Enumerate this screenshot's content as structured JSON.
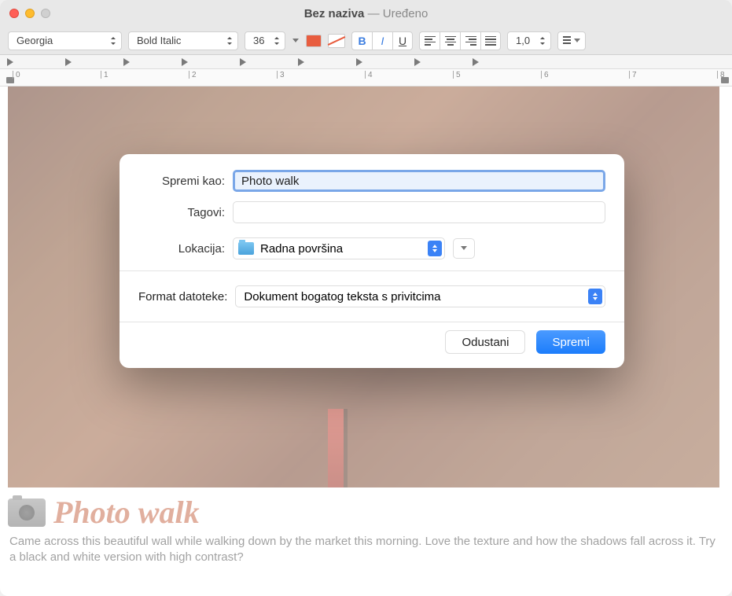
{
  "window": {
    "title_main": "Bez naziva",
    "title_edited": "— Uređeno"
  },
  "toolbar": {
    "font": "Georgia",
    "style": "Bold Italic",
    "size": "36",
    "spacing": "1,0"
  },
  "ruler": {
    "marks": [
      "0",
      "1",
      "2",
      "3",
      "4",
      "5",
      "6",
      "7",
      "8"
    ]
  },
  "document": {
    "heading": "Photo walk",
    "body": "Came across this beautiful wall while walking down by the market this morning. Love the texture and how the shadows fall across it. Try a black and white version with high contrast?"
  },
  "dialog": {
    "save_as_label": "Spremi kao:",
    "save_as_value": "Photo walk",
    "tags_label": "Tagovi:",
    "tags_value": "",
    "location_label": "Lokacija:",
    "location_value": "Radna površina",
    "format_label": "Format datoteke:",
    "format_value": "Dokument bogatog teksta s privitcima",
    "cancel": "Odustani",
    "save": "Spremi"
  }
}
